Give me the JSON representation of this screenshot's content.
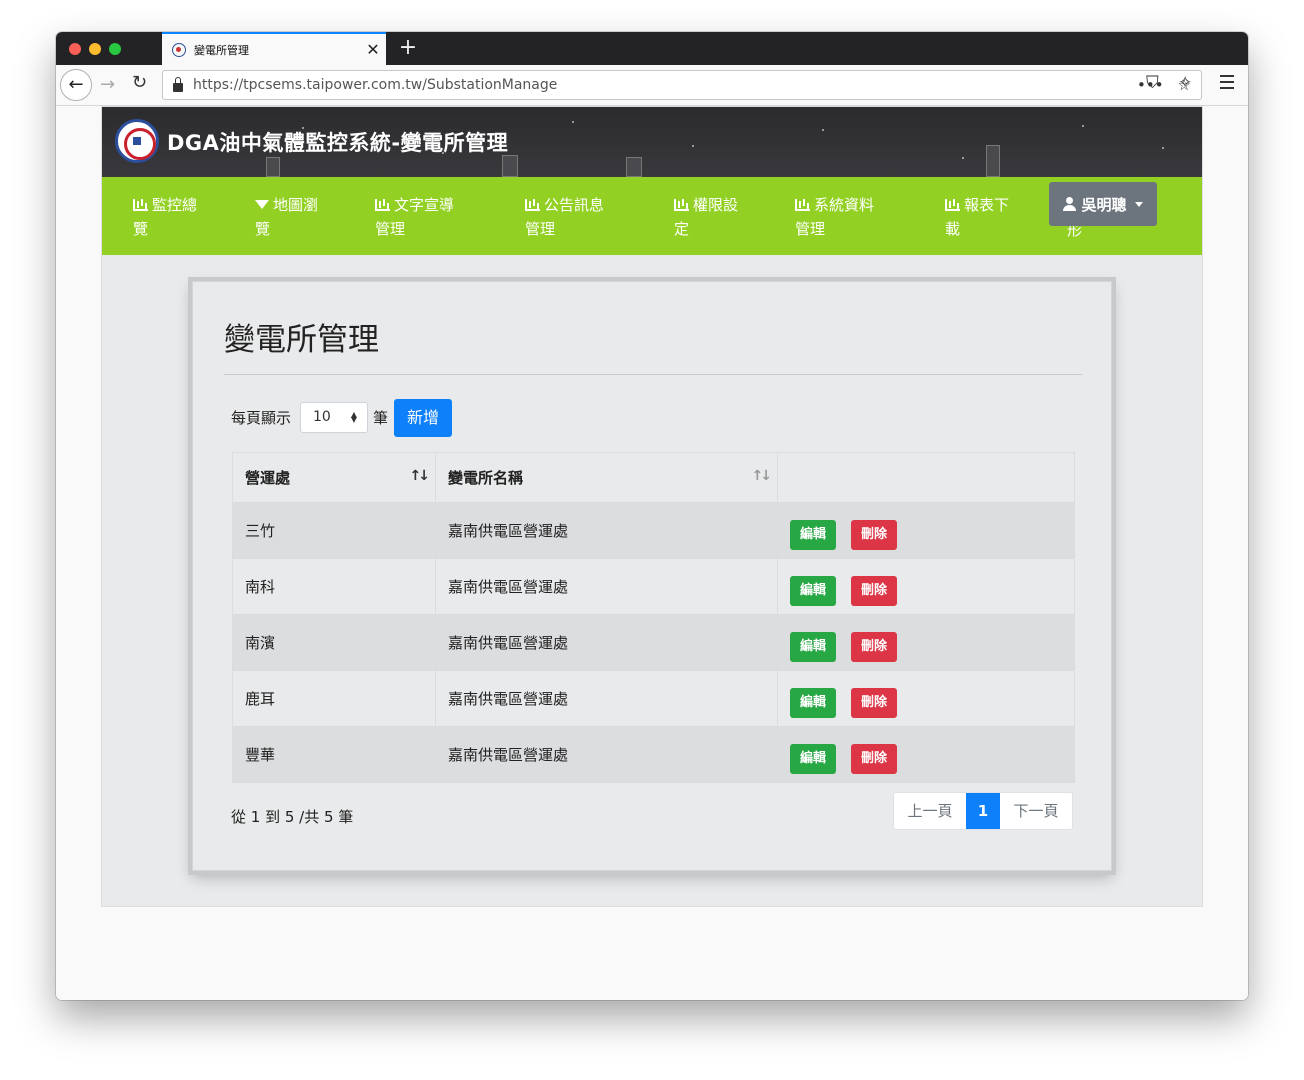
{
  "browser": {
    "tab_title": "變電所管理",
    "url": "https://tpcsems.taipower.com.tw/SubstationManage"
  },
  "app": {
    "title": "DGA油中氣體監控系統-變電所管理",
    "menu": [
      {
        "line1": "監控總",
        "line2": "覽"
      },
      {
        "line1": "地圖瀏",
        "line2": "覽"
      },
      {
        "line1": "文字宣導",
        "line2": "管理"
      },
      {
        "line1": "公告訊息",
        "line2": "管理"
      },
      {
        "line1": "權限設",
        "line2": "定"
      },
      {
        "line1": "系統資料",
        "line2": "管理"
      },
      {
        "line1": "報表下",
        "line2": "載"
      }
    ],
    "menu_peek": "形",
    "user_name": "吳明聰"
  },
  "page": {
    "title": "變電所管理",
    "length_label": "每頁顯示",
    "length_value": "10",
    "length_unit": "筆",
    "add_button": "新增",
    "columns": [
      "營運處",
      "變電所名稱",
      ""
    ],
    "rows": [
      {
        "district": "三竹",
        "name": "嘉南供電區營運處"
      },
      {
        "district": "南科",
        "name": "嘉南供電區營運處"
      },
      {
        "district": "南濱",
        "name": "嘉南供電區營運處"
      },
      {
        "district": "鹿耳",
        "name": "嘉南供電區營運處"
      },
      {
        "district": "豐華",
        "name": "嘉南供電區營運處"
      }
    ],
    "edit_label": "編輯",
    "delete_label": "刪除",
    "info": "從 1 到 5 /共 5 筆",
    "pagination": {
      "prev": "上一頁",
      "current": "1",
      "next": "下一頁"
    }
  },
  "colors": {
    "menu": "#93d024",
    "primary": "#0d80fa",
    "success": "#28a745",
    "danger": "#dc3545"
  }
}
